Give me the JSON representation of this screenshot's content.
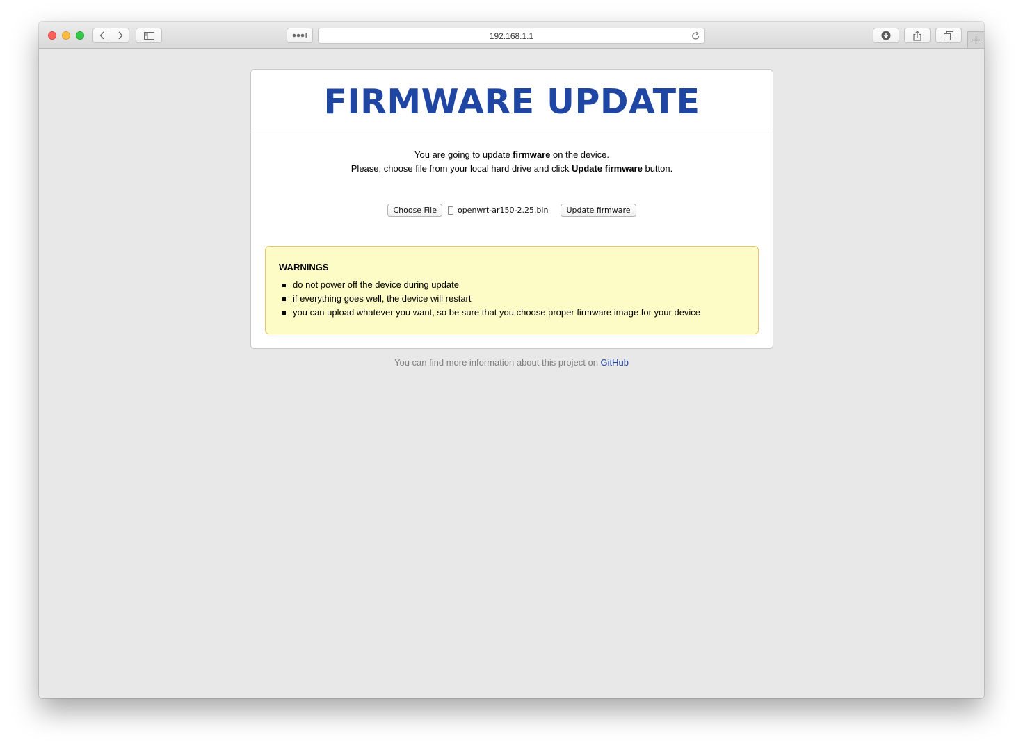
{
  "browser": {
    "url": "192.168.1.1",
    "icons": {
      "back": "chevron-left-icon",
      "forward": "chevron-right-icon",
      "sidebar": "sidebar-icon",
      "reader": "more-dots-icon",
      "reload": "reload-icon",
      "downloads": "download-icon",
      "share": "share-icon",
      "tabs": "tabs-icon",
      "new_tab": "plus-icon"
    }
  },
  "page": {
    "title": "FIRMWARE UPDATE",
    "intro_line1_pre": "You are going to update ",
    "intro_line1_bold": "firmware",
    "intro_line1_post": " on the device.",
    "intro_line2_pre": "Please, choose file from your local hard drive and click ",
    "intro_line2_bold": "Update firmware",
    "intro_line2_post": " button.",
    "choose_file_label": "Choose File",
    "file_name": "openwrt-ar150-2.25.bin",
    "update_button_label": "Update firmware",
    "warnings": {
      "title": "WARNINGS",
      "items": [
        "do not power off the device during update",
        "if everything goes well, the device will restart",
        "you can upload whatever you want, so be sure that you choose proper firmware image for your device"
      ]
    },
    "footer_text": "You can find more information about this project on ",
    "footer_link": "GitHub"
  },
  "colors": {
    "title": "#2046a3",
    "warning_bg": "#fdfcc6",
    "warning_border": "#e8c667",
    "page_bg": "#e8e8e8"
  }
}
